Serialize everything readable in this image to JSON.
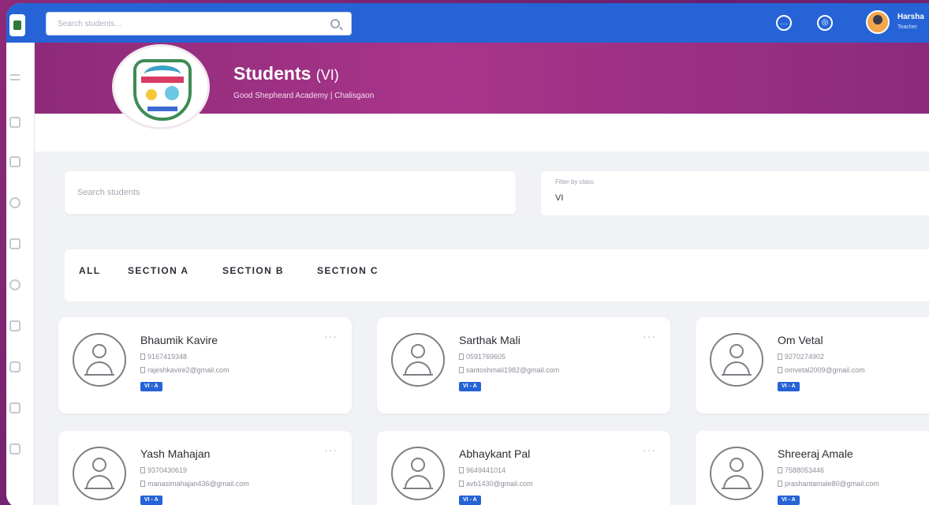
{
  "topbar": {
    "search_placeholder": "Search students...",
    "user_name": "Harsha",
    "user_role": "Teacher"
  },
  "banner": {
    "title": "Students",
    "title_suffix": "(VI)",
    "subtitle": "Good Shepheard Academy | Chalisgaon"
  },
  "filters": {
    "search_placeholder": "Search students",
    "class_label": "Filter by class",
    "class_value": "VI"
  },
  "tabs": [
    {
      "label": "ALL"
    },
    {
      "label": "SECTION A"
    },
    {
      "label": "SECTION B"
    },
    {
      "label": "SECTION C"
    }
  ],
  "students": [
    {
      "name": "Bhaumik Kavire",
      "phone": "9167419348",
      "email": "rajeshkavire2@gmail.com",
      "section": "VI - A"
    },
    {
      "name": "Sarthak Mali",
      "phone": "0591769605",
      "email": "santoshmali1982@gmail.com",
      "section": "VI - A"
    },
    {
      "name": "Om Vetal",
      "phone": "9270274902",
      "email": "omvetal2009@gmail.com",
      "section": "VI - A"
    },
    {
      "name": "Yash Mahajan",
      "phone": "9370430619",
      "email": "manasimahajan436@gmail.com",
      "section": "VI - A"
    },
    {
      "name": "Abhaykant Pal",
      "phone": "9649441014",
      "email": "avb1430@gmail.com",
      "section": "VI - A"
    },
    {
      "name": "Shreeraj Amale",
      "phone": "7588053446",
      "email": "prashantamale80@gmail.com",
      "section": "VI - A"
    }
  ],
  "colors": {
    "topbar": "#2563d6",
    "banner": "#a8358a",
    "badge": "#2563d6"
  }
}
